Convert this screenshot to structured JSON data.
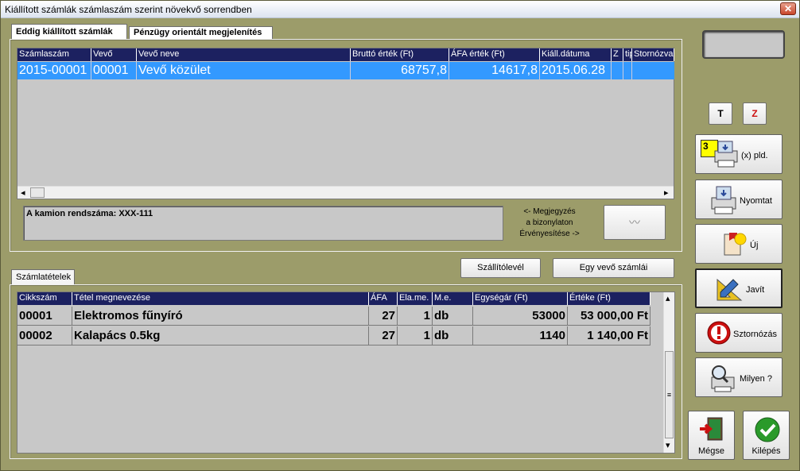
{
  "window": {
    "title": "Kiállított számlák számlaszám szerint növekvő sorrendben",
    "close_symbol": "✕"
  },
  "tabs": {
    "tab1": "Eddig kiállított számlák",
    "tab2": "Pénzügy orientált megjelenítés",
    "items_tab": "Számlatételek"
  },
  "invoice_grid": {
    "headers": [
      "Számlaszám",
      "Vevő",
      "Vevő neve",
      "Bruttó érték (Ft)",
      "ÁFA érték (Ft)",
      "Kiáll.dátuma",
      "Z",
      "tip",
      "Stornózva"
    ],
    "rows": [
      {
        "szamlaszam": "2015-00001",
        "vevo": "00001",
        "vevo_neve": "Vevő közület",
        "brutto": "68757,8",
        "afa": "14617,8",
        "datum": "2015.06.28"
      }
    ]
  },
  "note": {
    "text": "A kamion rendszáma: XXX-111"
  },
  "note_hint": {
    "line1": "<- Megjegyzés",
    "line2": "a bizonylaton",
    "line3": "Érvényesítése ->"
  },
  "buttons": {
    "t": "T",
    "z": "Z",
    "copies_value": "3",
    "copies_label": "(x) pld.",
    "print": "Nyomtat",
    "new": "Új",
    "edit": "Javít",
    "storno": "Sztornózás",
    "what": "Milyen ?",
    "cancel": "Mégse",
    "exit": "Kilépés",
    "delivery_note": "Szállítólevél",
    "customer_invoices": "Egy vevő számlái",
    "validate_symbol": "〰"
  },
  "items_grid": {
    "headers": [
      "Cikkszám",
      "Tétel megnevezése",
      "ÁFA",
      "Ela.me.",
      "M.e.",
      "Egységár (Ft)",
      "Értéke (Ft)"
    ],
    "rows": [
      {
        "cikkszam": "00001",
        "nev": "Elektromos fűnyíró",
        "afa": "27",
        "mennyiseg": "1",
        "me": "db",
        "egysegar": "53000",
        "ertek": "53 000,00 Ft"
      },
      {
        "cikkszam": "00002",
        "nev": "Kalapács 0.5kg",
        "afa": "27",
        "mennyiseg": "1",
        "me": "db",
        "egysegar": "1140",
        "ertek": "1 140,00 Ft"
      }
    ]
  },
  "scroll": {
    "left": "◂",
    "right": "▸",
    "up": "▴",
    "down": "▾",
    "grip": "≡"
  },
  "colors": {
    "selection": "#3399ff",
    "header": "#1c2160",
    "background": "#9c9c6a",
    "storno_red": "#cc1010",
    "exit_green": "#2a9a2a"
  }
}
